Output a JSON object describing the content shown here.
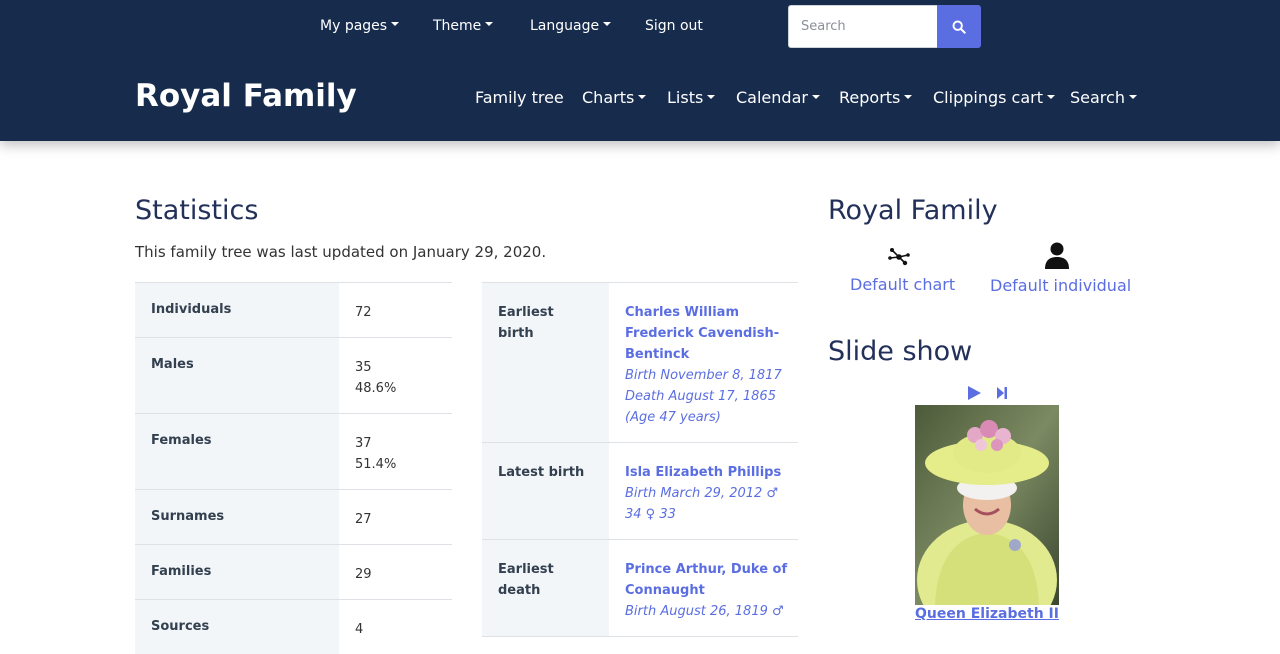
{
  "topnav": {
    "my_pages": "My pages",
    "theme": "Theme",
    "language": "Language",
    "sign_out": "Sign out",
    "search_placeholder": "Search"
  },
  "header": {
    "title": "Royal Family"
  },
  "mainnav": {
    "family_tree": "Family tree",
    "charts": "Charts",
    "lists": "Lists",
    "calendar": "Calendar",
    "reports": "Reports",
    "clippings_cart": "Clippings cart",
    "search": "Search"
  },
  "statistics": {
    "title": "Statistics",
    "updated": "This family tree was last updated on January 29, 2020.",
    "rows": [
      {
        "label": "Individuals",
        "value": "72",
        "value2": ""
      },
      {
        "label": "Males",
        "value": "35",
        "value2": "48.6%"
      },
      {
        "label": "Females",
        "value": "37",
        "value2": "51.4%"
      },
      {
        "label": "Surnames",
        "value": "27",
        "value2": ""
      },
      {
        "label": "Families",
        "value": "29",
        "value2": ""
      },
      {
        "label": "Sources",
        "value": "4",
        "value2": ""
      }
    ],
    "births": [
      {
        "label": "Earliest birth",
        "name": "Charles William Frederick Cavendish-Bentinck",
        "d1": "Birth November 8, 1817",
        "d2": "Death August 17, 1865",
        "d3": "(Age 47 years)"
      },
      {
        "label": "Latest birth",
        "name": "Isla Elizabeth Phillips",
        "d1": "Birth March 29, 2012 ♂ 34 ♀ 33",
        "d2": "",
        "d3": ""
      },
      {
        "label": "Earliest death",
        "name": "Prince Arthur, Duke of Connaught",
        "d1": "Birth August 26, 1819 ♂",
        "d2": "",
        "d3": ""
      }
    ]
  },
  "sidebar": {
    "title": "Royal Family",
    "default_chart": "Default chart",
    "default_individual": "Default individual",
    "slideshow_title": "Slide show",
    "photo_caption": "Queen Elizabeth II"
  },
  "colors": {
    "header_bg": "#172b4d",
    "accent": "#5b6ee1",
    "heading": "#22305a"
  },
  "icons": [
    "caret-down-icon",
    "search-icon",
    "chart-nodes-icon",
    "person-icon",
    "play-icon",
    "skip-next-icon"
  ]
}
